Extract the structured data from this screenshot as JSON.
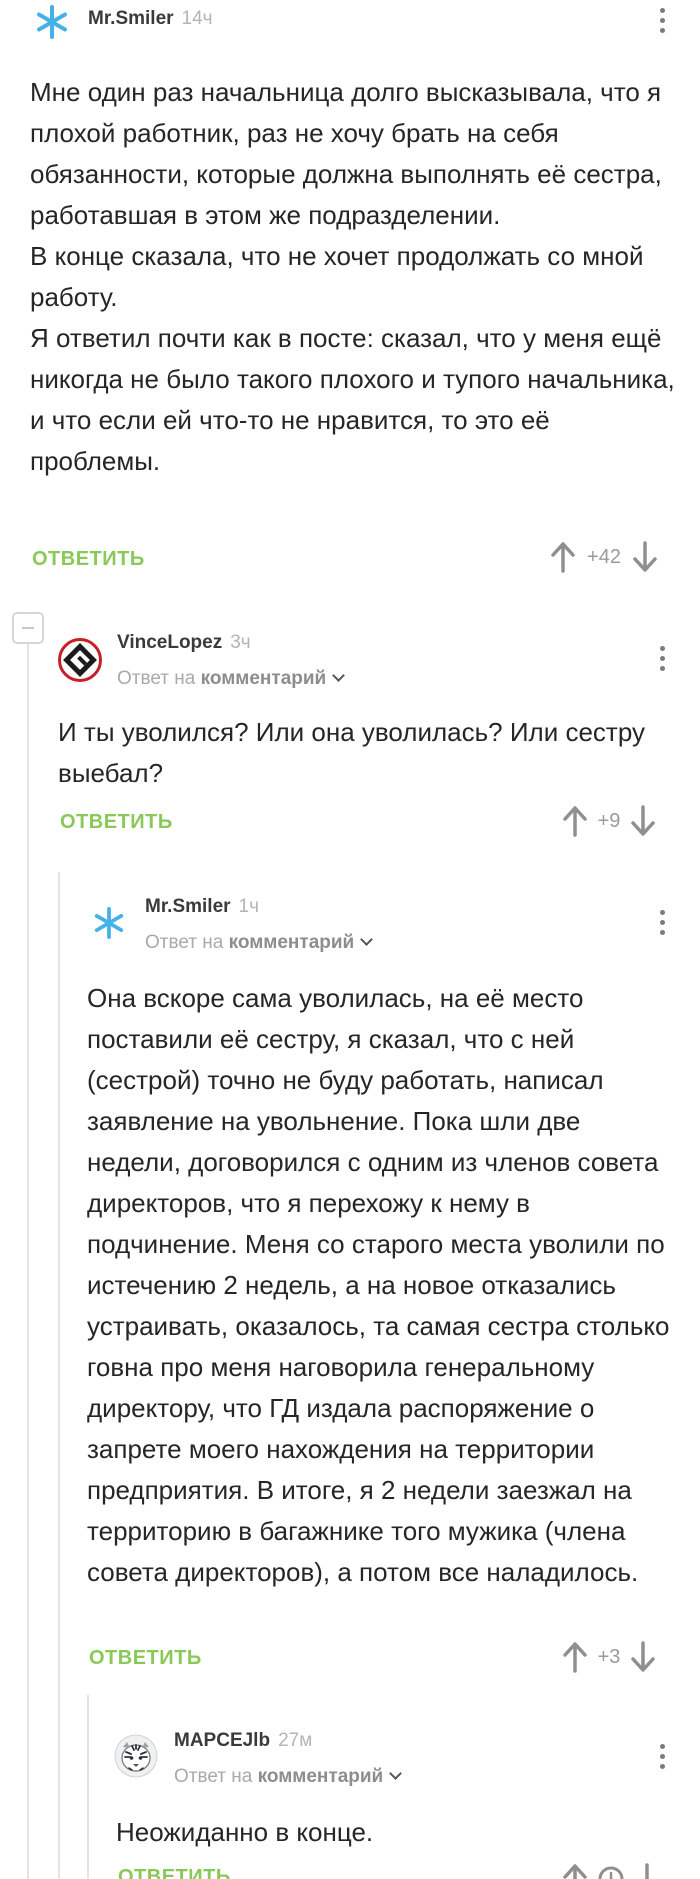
{
  "comments": [
    {
      "username": "Mr.Smiler",
      "time": "14ч",
      "paragraphs": [
        "Мне один раз начальница долго высказывала, что я плохой работник, раз не хочу брать на себя обязанности, которые должна выполнять её сестра, работавшая в этом же подразделении.",
        "В конце сказала, что не хочет продолжать со мной работу.",
        "Я ответил почти как в посте: сказал, что у меня ещё никогда не было такого плохого и тупого начальника, и что если ей что-то не нравится, то это её проблемы."
      ],
      "reply_label": "ОТВЕТИТЬ",
      "score": "+42"
    },
    {
      "username": "VinceLopez",
      "time": "3ч",
      "reply_prefix": "Ответ на",
      "reply_target": "комментарий",
      "paragraphs": [
        "И ты уволился? Или она уволилась? Или сестру выебал?"
      ],
      "reply_label": "ОТВЕТИТЬ",
      "score": "+9"
    },
    {
      "username": "Mr.Smiler",
      "time": "1ч",
      "reply_prefix": "Ответ на",
      "reply_target": "комментарий",
      "paragraphs": [
        "Она вскоре сама уволилась, на её место поставили её сестру, я сказал, что с ней (сестрой) точно не буду работать, написал заявление на увольнение. Пока шли две недели, договорился с одним из членов совета директоров, что я перехожу к нему в подчинение. Меня со старого места уволили по истечению 2 недель, а на новое отказались устраивать, оказалось, та самая сестра столько говна про меня наговорила генеральному директору, что ГД издала распоряжение о запрете моего нахождения на территории предприятия. В итоге, я 2 недели заезжал на территорию в багажнике того мужика (члена совета директоров), а потом все наладилось."
      ],
      "reply_label": "ОТВЕТИТЬ",
      "score": "+3"
    },
    {
      "username": "MAPCEJlb",
      "time": "27м",
      "reply_prefix": "Ответ на",
      "reply_target": "комментарий",
      "paragraphs": [
        "Неожиданно в конце."
      ],
      "reply_label": "ОТВЕТИТЬ"
    }
  ],
  "colors": {
    "accent_green": "#8ac858",
    "snowflake_blue": "#45b1e8",
    "text": "#262626",
    "muted": "#a9a9a9"
  },
  "icons": {
    "avatar_1": "snowflake-icon",
    "avatar_2": "g-logo-icon",
    "avatar_3": "snowflake-icon",
    "avatar_4": "tiger-icon"
  }
}
